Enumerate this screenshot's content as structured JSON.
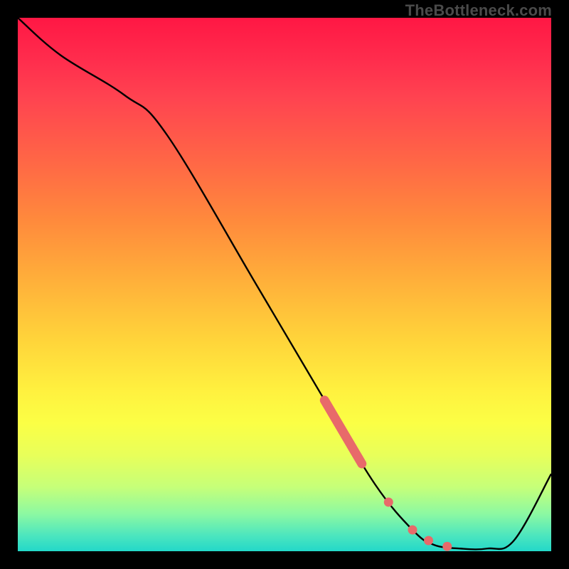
{
  "watermark": "TheBottleneck.com",
  "colors": {
    "dot": "#e86a6a",
    "line": "#000000"
  },
  "chart_data": {
    "type": "line",
    "title": "",
    "xlabel": "",
    "ylabel": "",
    "xlim": [
      0,
      100
    ],
    "ylim": [
      0,
      100
    ],
    "grid": false,
    "series": [
      {
        "name": "curve",
        "x": [
          0,
          8,
          20,
          28,
          45,
          58,
          67,
          74,
          78,
          83,
          88,
          93,
          100
        ],
        "values": [
          100,
          93,
          85.5,
          78,
          49.5,
          27.5,
          12.5,
          4,
          1.2,
          0.5,
          0.5,
          2,
          14.5
        ]
      },
      {
        "name": "highlighted-segment",
        "x": [
          57.5,
          58.5,
          59.5,
          60.5,
          61.5,
          62.5,
          63.5,
          64.5
        ],
        "values": [
          28.3,
          26.6,
          24.9,
          23.2,
          21.5,
          19.8,
          18.1,
          16.4
        ]
      }
    ],
    "dots": [
      {
        "x": 69.5,
        "y": 9.2
      },
      {
        "x": 74.0,
        "y": 4.0
      },
      {
        "x": 77.0,
        "y": 2.0
      },
      {
        "x": 80.5,
        "y": 0.9
      }
    ]
  }
}
